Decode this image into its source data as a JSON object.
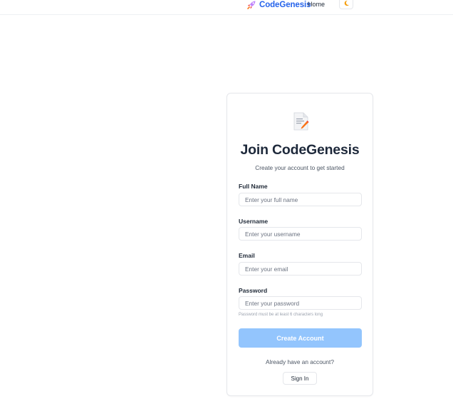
{
  "navbar": {
    "brand_icon": "rocket-icon",
    "brand_name": "CodeGenesis",
    "home_label": "Home",
    "theme_icon": "moon-icon"
  },
  "form": {
    "icon": "memo-icon",
    "title": "Join CodeGenesis",
    "subtitle": "Create your account to get started",
    "fields": [
      {
        "label": "Full Name",
        "placeholder": "Enter your full name",
        "value": ""
      },
      {
        "label": "Username",
        "placeholder": "Enter your username",
        "value": ""
      },
      {
        "label": "Email",
        "placeholder": "Enter your email",
        "value": ""
      },
      {
        "label": "Password",
        "placeholder": "Enter your password",
        "value": ""
      }
    ],
    "password_hint": "Password must be at least 6 characters long",
    "submit_label": "Create Account",
    "switch_prompt": "Already have an account?",
    "signin_label": "Sign In"
  },
  "colors": {
    "brand": "#2563eb",
    "submit_button": "#93c5fd",
    "moon": "#f59e0b"
  }
}
